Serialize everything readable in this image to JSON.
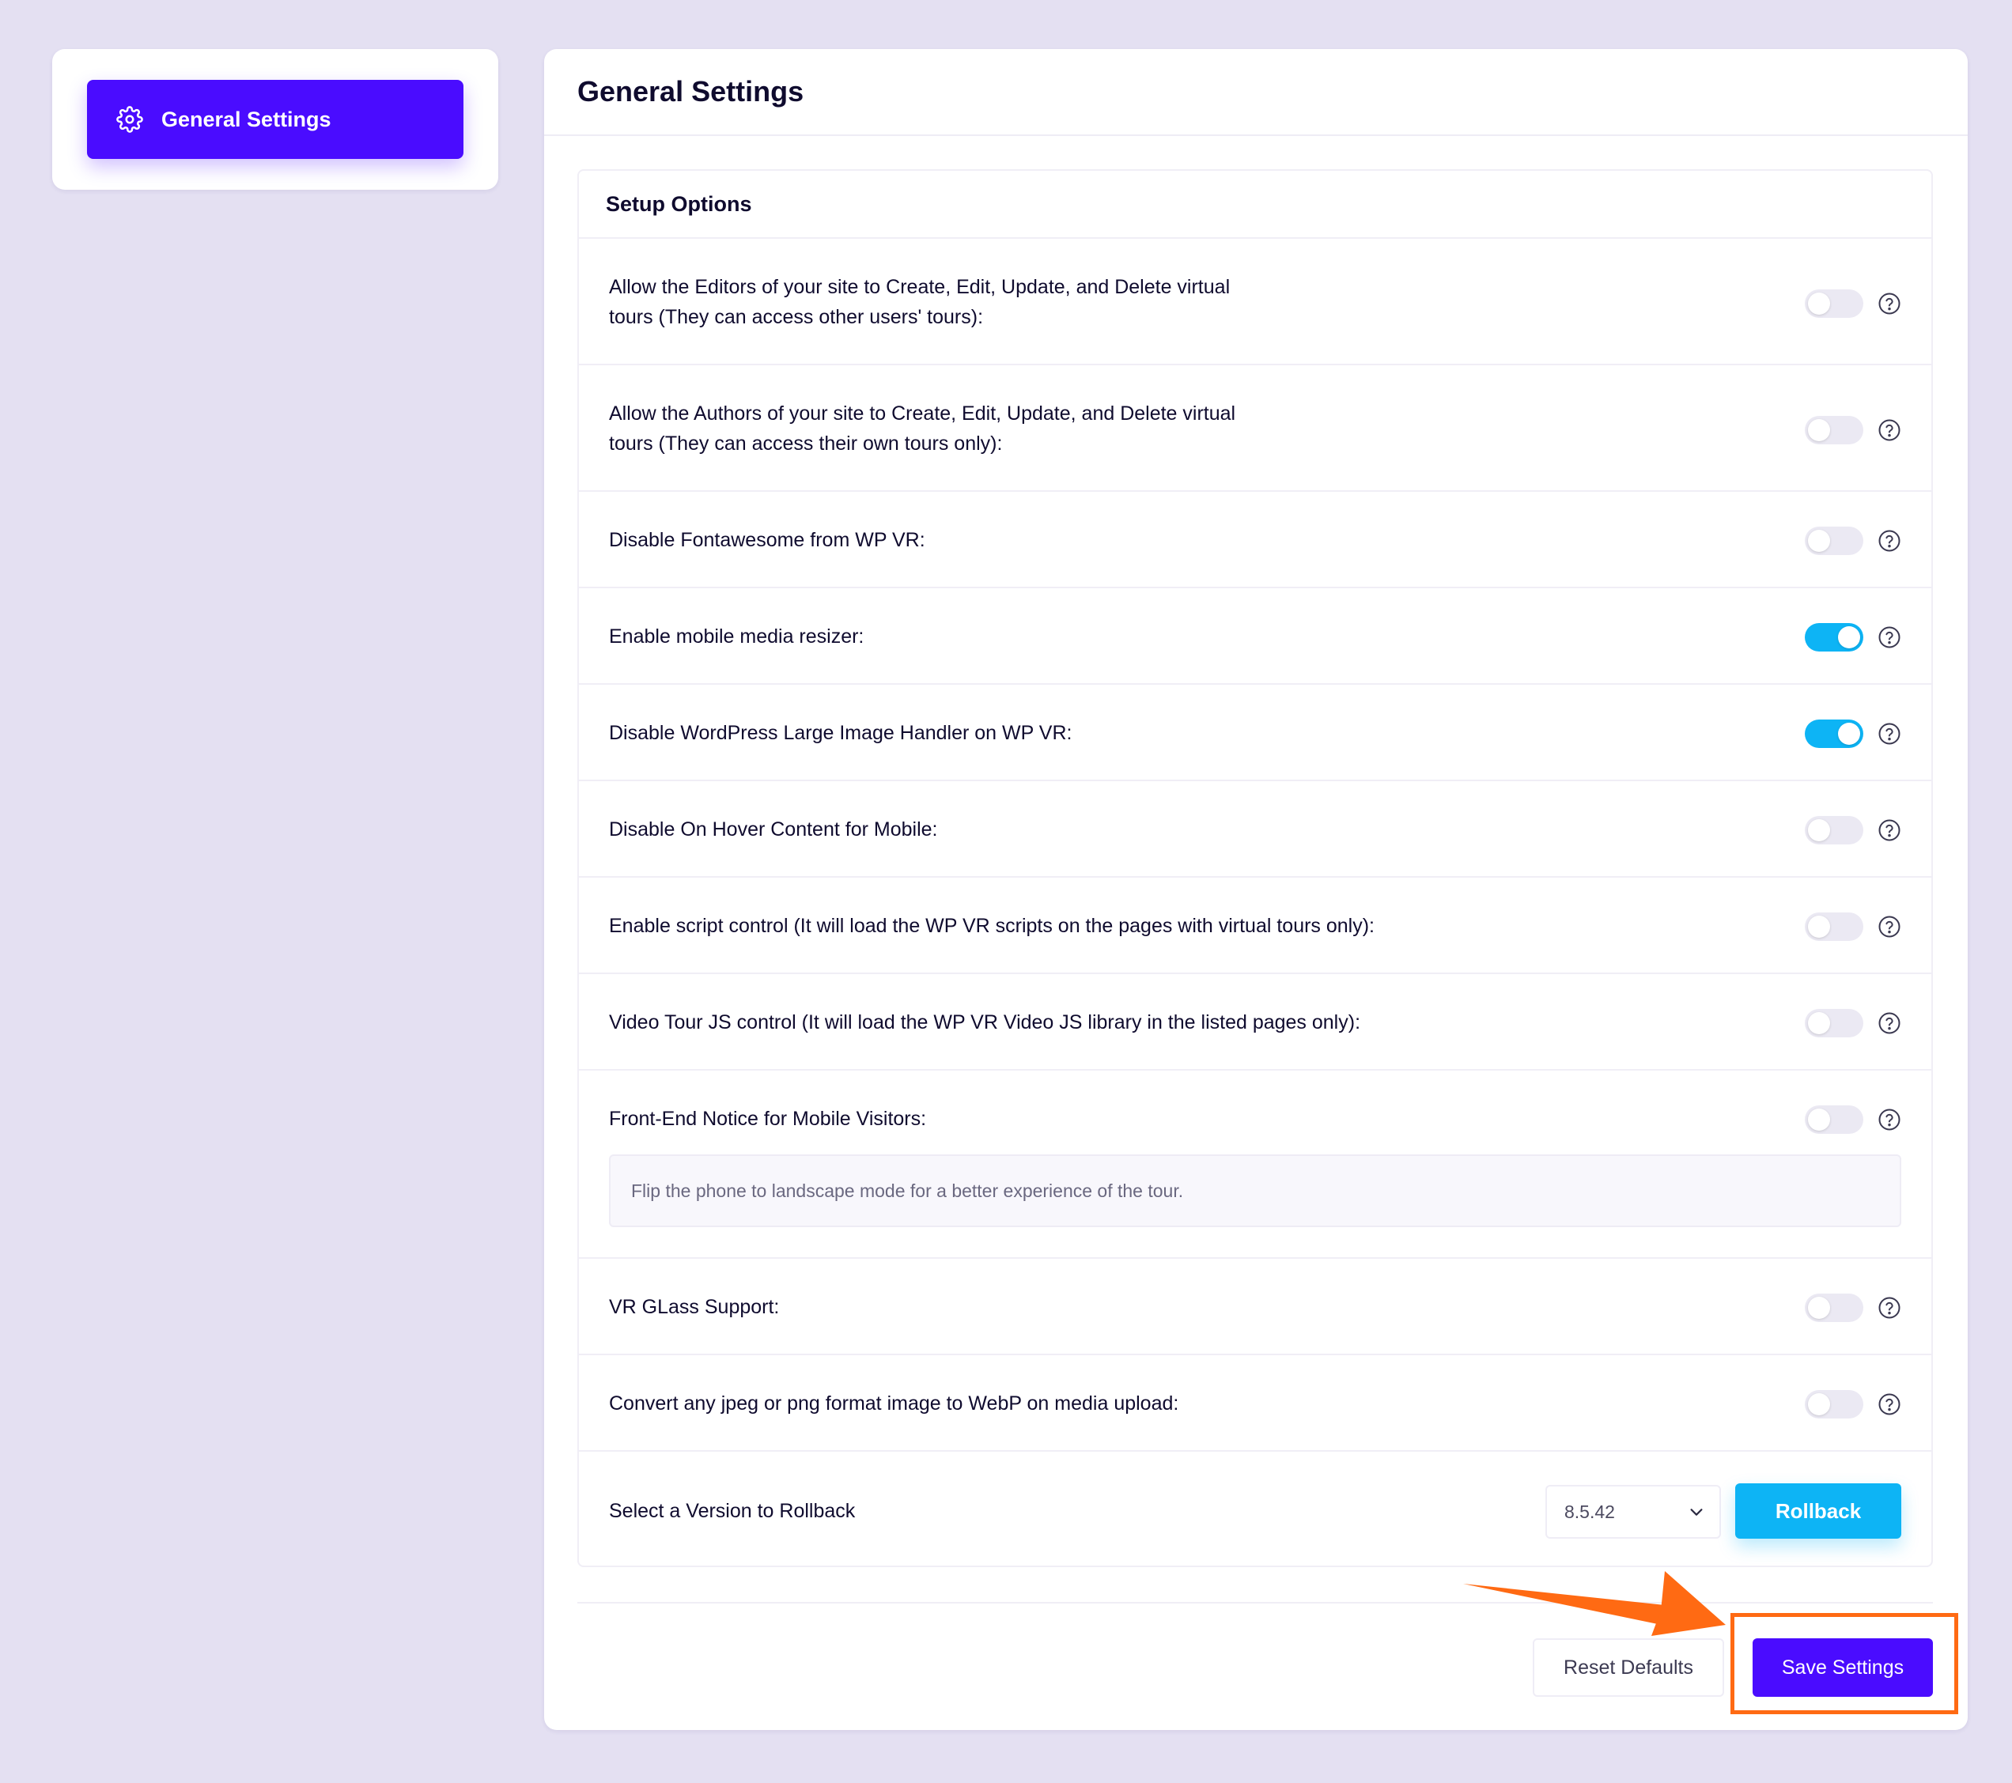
{
  "sidebar": {
    "nav_label": "General Settings",
    "icon": "gear-icon"
  },
  "main": {
    "title": "General Settings",
    "section_title": "Setup Options",
    "options": [
      {
        "label_line1": "Allow the Editors of your site to Create, Edit, Update, and Delete virtual",
        "label_line2": "tours (They can access other users' tours):",
        "enabled": false
      },
      {
        "label_line1": "Allow the Authors of your site to Create, Edit, Update, and Delete virtual",
        "label_line2": "tours (They can access their own tours only):",
        "enabled": false
      },
      {
        "label": "Disable Fontawesome from WP VR:",
        "enabled": false
      },
      {
        "label": "Enable mobile media resizer:",
        "enabled": true
      },
      {
        "label": "Disable WordPress Large Image Handler on WP VR:",
        "enabled": true
      },
      {
        "label": "Disable On Hover Content for Mobile:",
        "enabled": false
      },
      {
        "label": "Enable script control (It will load the WP VR scripts on the pages with virtual tours only):",
        "enabled": false
      },
      {
        "label": "Video Tour JS control (It will load the WP VR Video JS library in the listed pages only):",
        "enabled": false
      },
      {
        "label": "Front-End Notice for Mobile Visitors:",
        "enabled": false,
        "notice_placeholder": "Flip the phone to landscape mode for a better experience of the tour."
      },
      {
        "label": "VR GLass Support:",
        "enabled": false
      },
      {
        "label": "Convert any jpeg or png format image to WebP on media upload:",
        "enabled": false
      }
    ],
    "rollback": {
      "label": "Select a Version to Rollback",
      "selected_version": "8.5.42",
      "button_label": "Rollback"
    },
    "footer": {
      "reset_label": "Reset Defaults",
      "save_label": "Save Settings"
    }
  },
  "colors": {
    "primary": "#4a0cff",
    "toggle_on": "#0db4f5",
    "toggle_off": "#ebe9f3",
    "annotation": "#ff6a13",
    "background": "#e4e0f2"
  }
}
